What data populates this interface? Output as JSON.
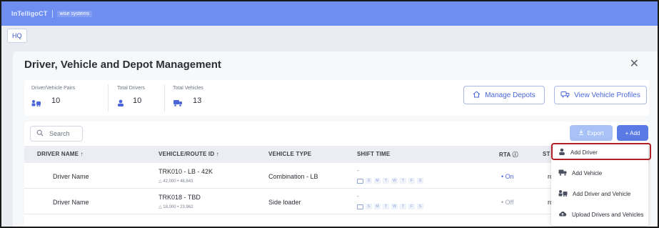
{
  "colors": {
    "topbar": "#6f8ef1",
    "accent": "#4a66d8",
    "add_button": "#5b7be4",
    "export_button": "#a8c1f7",
    "rta_on": "#4a66d8",
    "rta_off": "#9aa3b2",
    "highlight_border": "#b11f26"
  },
  "topbar": {
    "brand": "InTelligoCT",
    "partner": "wise systems"
  },
  "location_tab": "HQ",
  "modal": {
    "title": "Driver, Vehicle and Depot Management",
    "close_icon": "close-icon"
  },
  "stats": [
    {
      "label": "Driver/Vehicle Pairs",
      "value": "10",
      "icon": "driver-vehicle-icon"
    },
    {
      "label": "Total Drivers",
      "value": "10",
      "icon": "person-icon"
    },
    {
      "label": "Total Vehicles",
      "value": "13",
      "icon": "truck-icon"
    }
  ],
  "actions": {
    "manage_depots": "Manage Depots",
    "view_vehicle_profiles": "View Vehicle Profiles"
  },
  "toolbar": {
    "search_placeholder": "Search",
    "export_label": "Export",
    "add_label": "+ Add"
  },
  "table": {
    "columns": [
      "DRIVER NAME ↑",
      "VEHICLE/ROUTE ID ↑",
      "VEHICLE TYPE",
      "SHIFT TIME",
      "RTA",
      "ST"
    ],
    "rows": [
      {
        "driver": "Driver Name",
        "vehicle_id": "TRK010 - LB - 42K",
        "vehicle_meta": "42,000 • 48,843",
        "vehicle_type": "Combination - LB",
        "shift_dash": "-",
        "days": [
          "S",
          "M",
          "T",
          "W",
          "T",
          "F",
          "S"
        ],
        "rta": "• On",
        "status_partial": "ro"
      },
      {
        "driver": "Driver Name",
        "vehicle_id": "TRK018 - TBD",
        "vehicle_meta": "18,000 • 23,962",
        "vehicle_type": "Side loader",
        "shift_dash": "-",
        "days": [
          "S",
          "M",
          "T",
          "W",
          "T",
          "F",
          "S"
        ],
        "rta": "• Off",
        "status_partial": "ro"
      }
    ]
  },
  "add_menu": [
    {
      "label": "Add Driver",
      "icon": "person-icon",
      "highlighted": true
    },
    {
      "label": "Add Vehicle",
      "icon": "truck-icon",
      "highlighted": false
    },
    {
      "label": "Add Driver and Vehicle",
      "icon": "driver-vehicle-icon",
      "highlighted": false
    },
    {
      "label": "Upload Drivers and Vehicles",
      "icon": "cloud-upload-icon",
      "highlighted": false
    }
  ]
}
